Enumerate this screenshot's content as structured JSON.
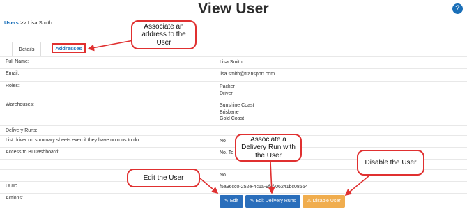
{
  "header": {
    "title": "View User",
    "help_icon": "?"
  },
  "breadcrumb": {
    "link": "Users",
    "separator": ">>",
    "current": "Lisa Smith"
  },
  "tabs": [
    {
      "label": "Details",
      "active": true
    },
    {
      "label": "Addresses",
      "active": false
    }
  ],
  "details": {
    "full_name": {
      "label": "Full Name:",
      "value": "Lisa Smith"
    },
    "email": {
      "label": "Email:",
      "value": "lisa.smith@transport.com"
    },
    "roles": {
      "label": "Roles:",
      "values": [
        "Packer",
        "Driver"
      ]
    },
    "warehouses": {
      "label": "Warehouses:",
      "values": [
        "Sunshine Coast",
        "Brisbane",
        "Gold Coast"
      ]
    },
    "delivery_runs": {
      "label": "Delivery Runs:",
      "value": ""
    },
    "list_driver": {
      "label": "List driver on summary sheets even if they have no runs to do:",
      "value": "No"
    },
    "bi_dashboard": {
      "label": "Access to BI Dashboard:",
      "value": "No. To"
    },
    "blank_row": {
      "label": "",
      "value": ""
    },
    "unlabeled_no": {
      "label": "",
      "value": "No"
    },
    "uuid": {
      "label": "UUID:",
      "value": "f5a96cc0-252e-4c1a-9f9f-06241bc08554"
    },
    "actions": {
      "label": "Actions:"
    }
  },
  "actions": {
    "edit": {
      "label": "Edit",
      "icon": "pencil-icon"
    },
    "edit_runs": {
      "label": "Edit Delivery Runs",
      "icon": "pencil-icon"
    },
    "disable": {
      "label": "Disable User",
      "icon": "warning-icon"
    }
  },
  "callouts": {
    "address": "Associate an address to the User",
    "delivery_run": "Associate a Delivery Run with the User",
    "edit": "Edit the User",
    "disable": "Disable the User"
  },
  "colors": {
    "link": "#1a6fb8",
    "primary_button": "#2a6ebb",
    "warning_button": "#f0ad4e",
    "callout_border": "#e03030"
  }
}
